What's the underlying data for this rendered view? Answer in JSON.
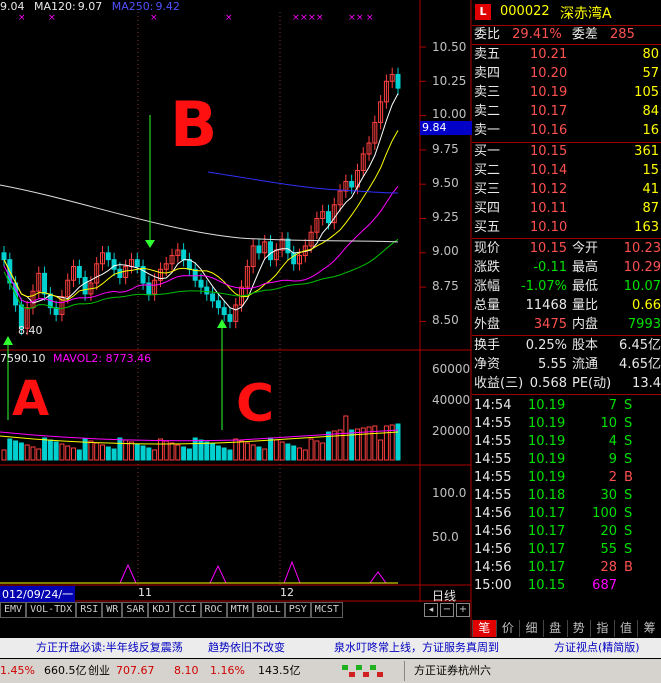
{
  "legend": {
    "ma10": "9.04",
    "ma120_label": "MA120:",
    "ma120": "9.07",
    "ma250_label": "MA250:",
    "ma250": "9.42",
    "vol_prefix": "7590.10",
    "mavol2": "MAVOL2: 8773.46"
  },
  "axis": {
    "price_ticks": [
      "10.50",
      "10.25",
      "10.00",
      "9.75",
      "9.50",
      "9.25",
      "9.00",
      "8.75",
      "8.50"
    ],
    "current_price": "9.84",
    "vol_ticks": [
      "60000",
      "40000",
      "20000"
    ],
    "ind_ticks": [
      "100.0",
      "50.0"
    ],
    "low_label": "8.40",
    "period": "日线"
  },
  "dates": {
    "d1": "012/09/24/一",
    "d2": "11",
    "d3": "12"
  },
  "indicator_tabs": [
    "EMV",
    "VOL-TDX",
    "RSI",
    "WR",
    "SAR",
    "KDJ",
    "CCI",
    "ROC",
    "MTM",
    "BOLL",
    "PSY",
    "MCST"
  ],
  "annotations": {
    "a": "A",
    "b": "B",
    "c": "C"
  },
  "stock": {
    "code": "000022",
    "name": "深赤湾A",
    "logo": "L"
  },
  "ratio": {
    "label1": "委比",
    "value1": "29.41%",
    "label2": "委差",
    "value2": "285"
  },
  "asks": [
    {
      "label": "卖五",
      "price": "10.21",
      "vol": "80"
    },
    {
      "label": "卖四",
      "price": "10.20",
      "vol": "57"
    },
    {
      "label": "卖三",
      "price": "10.19",
      "vol": "105"
    },
    {
      "label": "卖二",
      "price": "10.17",
      "vol": "84"
    },
    {
      "label": "卖一",
      "price": "10.16",
      "vol": "16"
    }
  ],
  "bids": [
    {
      "label": "买一",
      "price": "10.15",
      "vol": "361"
    },
    {
      "label": "买二",
      "price": "10.14",
      "vol": "15"
    },
    {
      "label": "买三",
      "price": "10.12",
      "vol": "41"
    },
    {
      "label": "买四",
      "price": "10.11",
      "vol": "87"
    },
    {
      "label": "买五",
      "price": "10.10",
      "vol": "163"
    }
  ],
  "quote": [
    {
      "l1": "现价",
      "v1": "10.15",
      "c1": "red",
      "l2": "今开",
      "v2": "10.23",
      "c2": "red"
    },
    {
      "l1": "涨跌",
      "v1": "-0.11",
      "c1": "grn",
      "l2": "最高",
      "v2": "10.29",
      "c2": "red"
    },
    {
      "l1": "涨幅",
      "v1": "-1.07%",
      "c1": "grn",
      "l2": "最低",
      "v2": "10.07",
      "c2": "grn"
    },
    {
      "l1": "总量",
      "v1": "11468",
      "c1": "wht",
      "l2": "量比",
      "v2": "0.66",
      "c2": "yel"
    },
    {
      "l1": "外盘",
      "v1": "3475",
      "c1": "red",
      "l2": "内盘",
      "v2": "7993",
      "c2": "grn"
    }
  ],
  "stats": [
    {
      "l1": "换手",
      "v1": "0.25%",
      "l2": "股本",
      "v2": "6.45亿"
    },
    {
      "l1": "净资",
      "v1": "5.55",
      "l2": "流通",
      "v2": "4.65亿"
    },
    {
      "l1": "收益(三)",
      "v1": "0.568",
      "l2": "PE(动)",
      "v2": "13.4"
    }
  ],
  "trades": [
    {
      "time": "14:54",
      "price": "10.19",
      "vol": "7",
      "side": "S",
      "pc": "grn",
      "sc": "grn"
    },
    {
      "time": "14:55",
      "price": "10.19",
      "vol": "10",
      "side": "S",
      "pc": "grn",
      "sc": "grn"
    },
    {
      "time": "14:55",
      "price": "10.19",
      "vol": "4",
      "side": "S",
      "pc": "grn",
      "sc": "grn"
    },
    {
      "time": "14:55",
      "price": "10.19",
      "vol": "9",
      "side": "S",
      "pc": "grn",
      "sc": "grn"
    },
    {
      "time": "14:55",
      "price": "10.19",
      "vol": "2",
      "side": "B",
      "pc": "grn",
      "sc": "red"
    },
    {
      "time": "14:55",
      "price": "10.18",
      "vol": "30",
      "side": "S",
      "pc": "grn",
      "sc": "grn"
    },
    {
      "time": "14:56",
      "price": "10.17",
      "vol": "100",
      "side": "S",
      "pc": "grn",
      "sc": "grn"
    },
    {
      "time": "14:56",
      "price": "10.17",
      "vol": "20",
      "side": "S",
      "pc": "grn",
      "sc": "grn"
    },
    {
      "time": "14:56",
      "price": "10.17",
      "vol": "55",
      "side": "S",
      "pc": "grn",
      "sc": "grn"
    },
    {
      "time": "14:56",
      "price": "10.17",
      "vol": "28",
      "side": "B",
      "pc": "grn",
      "sc": "red"
    },
    {
      "time": "15:00",
      "price": "10.15",
      "vol": "687",
      "side": "",
      "pc": "grn",
      "sc": "mag"
    }
  ],
  "bottom_tabs": [
    "笔",
    "价",
    "细",
    "盘",
    "势",
    "指",
    "值",
    "筹"
  ],
  "ticker": {
    "t1": "方正开盘必读:半年线反复震荡",
    "t2": "趋势依旧不改变",
    "t3": "泉水叮咚常上线，方证服务真周到",
    "t4": "方证视点(精简版)"
  },
  "status": {
    "s1": "1.45%",
    "s2": "660.5亿",
    "s3": "创业",
    "s4": "707.67",
    "s5": "8.10",
    "s6": "1.16%",
    "s7": "143.5亿",
    "s8": "方正证券杭州六"
  }
}
